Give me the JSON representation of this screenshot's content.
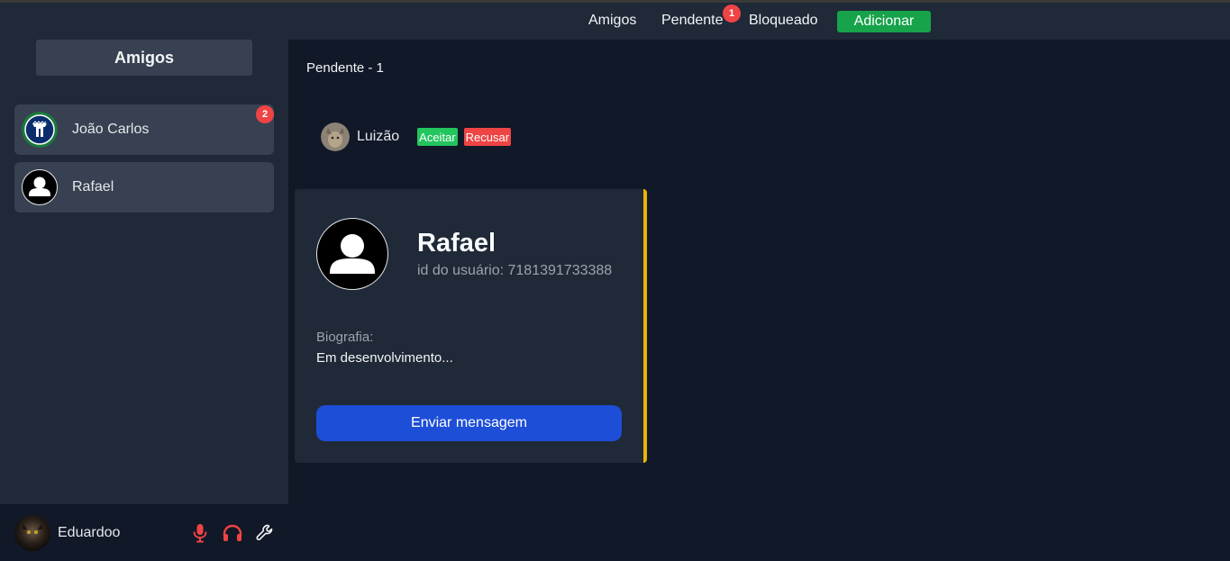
{
  "sidebar": {
    "title": "Amigos",
    "friends": [
      {
        "name": "João Carlos",
        "badge": "2",
        "avatar_icon": "shield-crest-icon"
      },
      {
        "name": "Rafael",
        "avatar_icon": "person-icon"
      }
    ]
  },
  "user_bar": {
    "username": "Eduardoo",
    "icons": [
      "microphone-icon",
      "headphones-icon",
      "wrench-icon"
    ]
  },
  "nav": {
    "friends_label": "Amigos",
    "pending_label": "Pendente",
    "pending_badge": "1",
    "blocked_label": "Bloqueado",
    "add_label": "Adicionar"
  },
  "pending": {
    "section_title": "Pendente - 1",
    "requests": [
      {
        "name": "Luizão",
        "accept_label": "Aceitar",
        "reject_label": "Recusar"
      }
    ]
  },
  "profile": {
    "name": "Rafael",
    "user_id": "id do usuário: 7181391733388",
    "bio_label": "Biografia:",
    "bio_text": "Em desenvolvimento...",
    "send_label": "Enviar mensagem"
  },
  "colors": {
    "accent_green": "#16a34a",
    "accept_green": "#22c55e",
    "badge_red": "#ef4444",
    "send_blue": "#1d4ed8",
    "card_border_yellow": "#eab308"
  }
}
